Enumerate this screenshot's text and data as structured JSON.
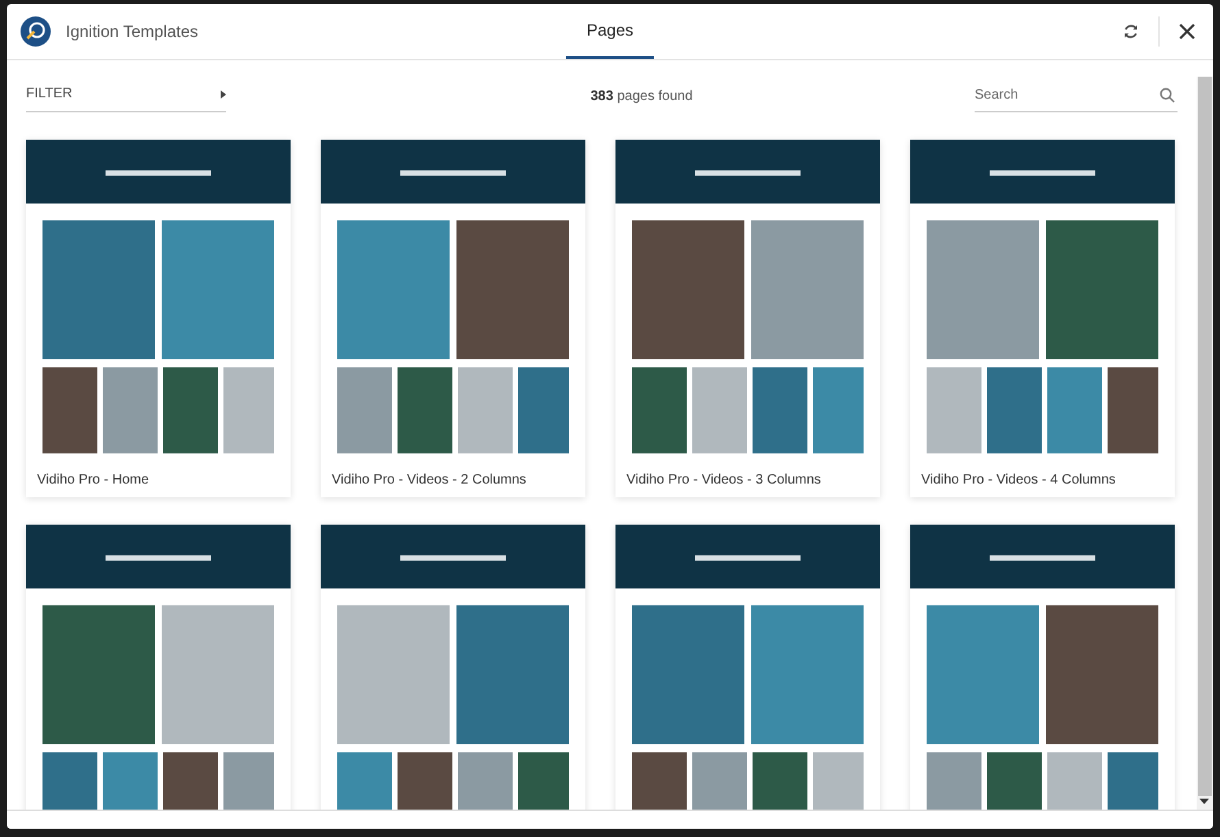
{
  "window": {
    "title": "Ignition Templates"
  },
  "tabs": [
    {
      "label": "Pages",
      "selected": true
    }
  ],
  "filter": {
    "label": "FILTER"
  },
  "results": {
    "count": "383",
    "text": "pages found"
  },
  "search": {
    "placeholder": "Search"
  },
  "pages": [
    {
      "kind": "captioned",
      "title": "Vidiho Pro - Home"
    },
    {
      "kind": "captioned",
      "title": "Vidiho Pro - Videos - 2 Columns"
    },
    {
      "kind": "captioned",
      "title": "Vidiho Pro - Videos - 3 Columns"
    },
    {
      "kind": "captioned",
      "title": "Vidiho Pro - Videos - 4 Columns"
    },
    {
      "kind": "preview"
    },
    {
      "kind": "preview"
    },
    {
      "kind": "preview"
    },
    {
      "kind": "preview"
    }
  ]
}
